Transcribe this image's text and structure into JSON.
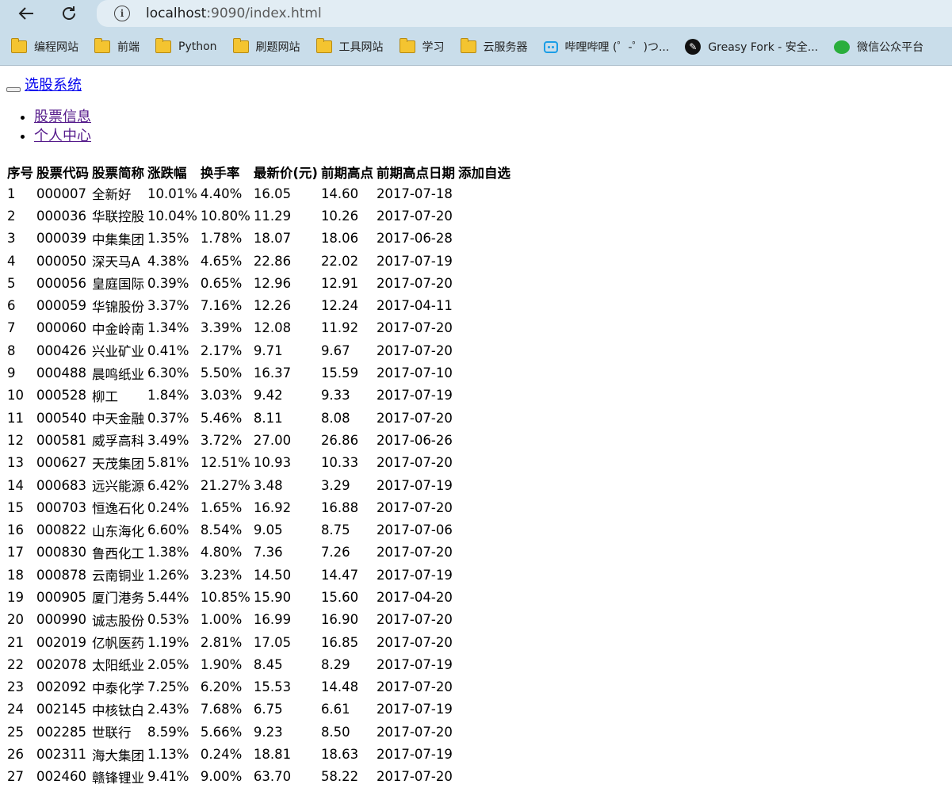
{
  "browser": {
    "url_host": "localhost",
    "url_rest": ":9090/index.html",
    "bookmarks": [
      {
        "label": "编程网站",
        "icon": "folder-icon"
      },
      {
        "label": "前端",
        "icon": "folder-icon"
      },
      {
        "label": "Python",
        "icon": "folder-icon"
      },
      {
        "label": "刷题网站",
        "icon": "folder-icon"
      },
      {
        "label": "工具网站",
        "icon": "folder-icon"
      },
      {
        "label": "学习",
        "icon": "folder-icon"
      },
      {
        "label": "云服务器",
        "icon": "folder-icon"
      },
      {
        "label": "哔哩哔哩 (゜-゜)つ...",
        "icon": "bilibili-icon"
      },
      {
        "label": "Greasy Fork - 安全...",
        "icon": "greasyfork-icon"
      },
      {
        "label": "微信公众平台",
        "icon": "wechat-icon"
      }
    ]
  },
  "app": {
    "brand": "选股系统",
    "nav": [
      "股票信息",
      "个人中心"
    ]
  },
  "table": {
    "headers": [
      "序号",
      "股票代码",
      "股票简称",
      "涨跌幅",
      "换手率",
      "最新价(元)",
      "前期高点",
      "前期高点日期",
      "添加自选"
    ],
    "rows": [
      [
        "1",
        "000007",
        "全新好",
        "10.01%",
        "4.40%",
        "16.05",
        "14.60",
        "2017-07-18"
      ],
      [
        "2",
        "000036",
        "华联控股",
        "10.04%",
        "10.80%",
        "11.29",
        "10.26",
        "2017-07-20"
      ],
      [
        "3",
        "000039",
        "中集集团",
        "1.35%",
        "1.78%",
        "18.07",
        "18.06",
        "2017-06-28"
      ],
      [
        "4",
        "000050",
        "深天马A",
        "4.38%",
        "4.65%",
        "22.86",
        "22.02",
        "2017-07-19"
      ],
      [
        "5",
        "000056",
        "皇庭国际",
        "0.39%",
        "0.65%",
        "12.96",
        "12.91",
        "2017-07-20"
      ],
      [
        "6",
        "000059",
        "华锦股份",
        "3.37%",
        "7.16%",
        "12.26",
        "12.24",
        "2017-04-11"
      ],
      [
        "7",
        "000060",
        "中金岭南",
        "1.34%",
        "3.39%",
        "12.08",
        "11.92",
        "2017-07-20"
      ],
      [
        "8",
        "000426",
        "兴业矿业",
        "0.41%",
        "2.17%",
        "9.71",
        "9.67",
        "2017-07-20"
      ],
      [
        "9",
        "000488",
        "晨鸣纸业",
        "6.30%",
        "5.50%",
        "16.37",
        "15.59",
        "2017-07-10"
      ],
      [
        "10",
        "000528",
        "柳工",
        "1.84%",
        "3.03%",
        "9.42",
        "9.33",
        "2017-07-19"
      ],
      [
        "11",
        "000540",
        "中天金融",
        "0.37%",
        "5.46%",
        "8.11",
        "8.08",
        "2017-07-20"
      ],
      [
        "12",
        "000581",
        "威孚高科",
        "3.49%",
        "3.72%",
        "27.00",
        "26.86",
        "2017-06-26"
      ],
      [
        "13",
        "000627",
        "天茂集团",
        "5.81%",
        "12.51%",
        "10.93",
        "10.33",
        "2017-07-20"
      ],
      [
        "14",
        "000683",
        "远兴能源",
        "6.42%",
        "21.27%",
        "3.48",
        "3.29",
        "2017-07-19"
      ],
      [
        "15",
        "000703",
        "恒逸石化",
        "0.24%",
        "1.65%",
        "16.92",
        "16.88",
        "2017-07-20"
      ],
      [
        "16",
        "000822",
        "山东海化",
        "6.60%",
        "8.54%",
        "9.05",
        "8.75",
        "2017-07-06"
      ],
      [
        "17",
        "000830",
        "鲁西化工",
        "1.38%",
        "4.80%",
        "7.36",
        "7.26",
        "2017-07-20"
      ],
      [
        "18",
        "000878",
        "云南铜业",
        "1.26%",
        "3.23%",
        "14.50",
        "14.47",
        "2017-07-19"
      ],
      [
        "19",
        "000905",
        "厦门港务",
        "5.44%",
        "10.85%",
        "15.90",
        "15.60",
        "2017-04-20"
      ],
      [
        "20",
        "000990",
        "诚志股份",
        "0.53%",
        "1.00%",
        "16.99",
        "16.90",
        "2017-07-20"
      ],
      [
        "21",
        "002019",
        "亿帆医药",
        "1.19%",
        "2.81%",
        "17.05",
        "16.85",
        "2017-07-20"
      ],
      [
        "22",
        "002078",
        "太阳纸业",
        "2.05%",
        "1.90%",
        "8.45",
        "8.29",
        "2017-07-19"
      ],
      [
        "23",
        "002092",
        "中泰化学",
        "7.25%",
        "6.20%",
        "15.53",
        "14.48",
        "2017-07-20"
      ],
      [
        "24",
        "002145",
        "中核钛白",
        "2.43%",
        "7.68%",
        "6.75",
        "6.61",
        "2017-07-19"
      ],
      [
        "25",
        "002285",
        "世联行",
        "8.59%",
        "5.66%",
        "9.23",
        "8.50",
        "2017-07-20"
      ],
      [
        "26",
        "002311",
        "海大集团",
        "1.13%",
        "0.24%",
        "18.81",
        "18.63",
        "2017-07-19"
      ],
      [
        "27",
        "002460",
        "赣锋锂业",
        "9.41%",
        "9.00%",
        "63.70",
        "58.22",
        "2017-07-20"
      ]
    ]
  }
}
